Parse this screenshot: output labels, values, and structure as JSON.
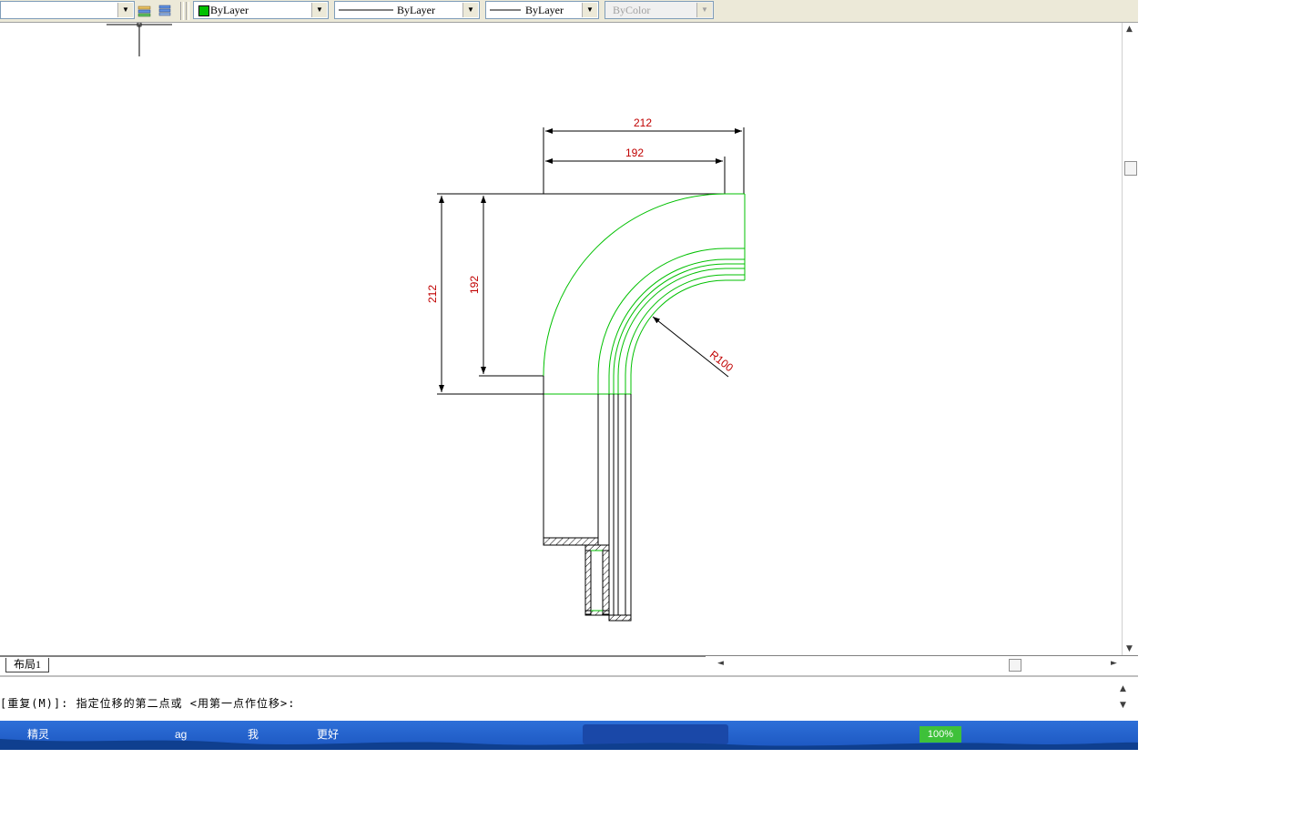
{
  "toolbar": {
    "layer_combo_value": "",
    "color_combo": {
      "value": "ByLayer",
      "swatch_color": "#00c000"
    },
    "linetype_combo": {
      "value": "ByLayer"
    },
    "lineweight_combo": {
      "value": "ByLayer"
    },
    "plotstyle_combo": {
      "value": "ByColor",
      "disabled": true
    },
    "dropdown_glyph": "▼"
  },
  "drawing": {
    "dimensions": {
      "top_outer_width": "212",
      "top_inner_width": "192",
      "left_outer_height": "212",
      "left_inner_height": "192",
      "radius_label": "R100"
    },
    "colors": {
      "geometry": "#00c000",
      "outline": "#000000",
      "dimension_text": "#c00000"
    }
  },
  "layout_tabs": [
    {
      "label": "布局1"
    }
  ],
  "command_line": {
    "prompt": "[重复(M)]: 指定位移的第二点或 <用第一点作位移>:"
  },
  "taskbar": {
    "items": [
      {
        "label": "精灵"
      },
      {
        "label": "ag"
      },
      {
        "label": "我"
      },
      {
        "label": "更好"
      }
    ],
    "tray_zoom": "100%"
  },
  "scroll_arrows": {
    "up": "▲",
    "down": "▼",
    "left": "◄",
    "right": "►"
  }
}
